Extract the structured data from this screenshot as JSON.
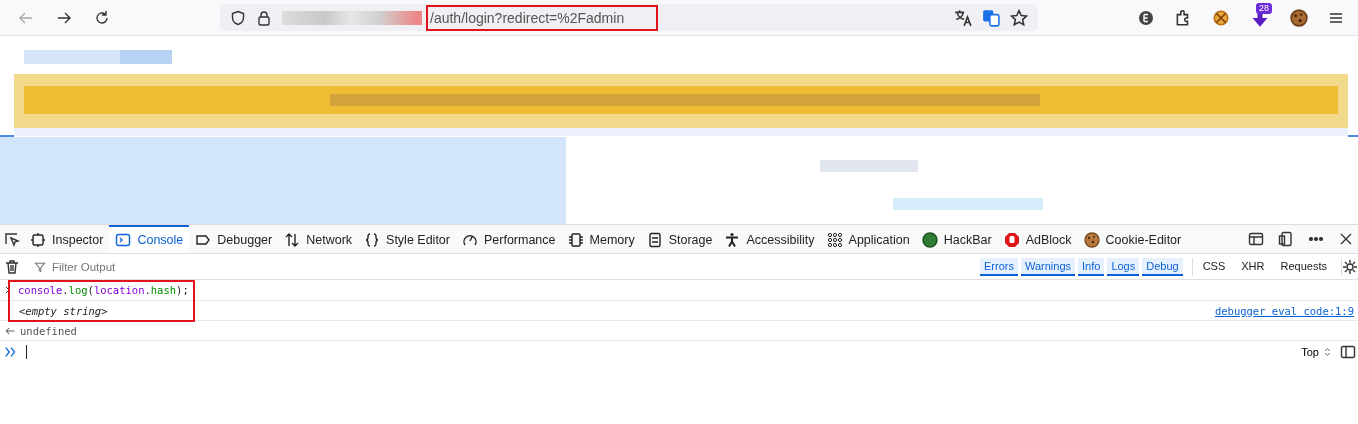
{
  "toolbar": {
    "url": "/auth/login?redirect=%2Fadmin",
    "extension_badge": "28"
  },
  "devtools": {
    "tabs": [
      {
        "label": "Inspector",
        "selected": false
      },
      {
        "label": "Console",
        "selected": true
      },
      {
        "label": "Debugger",
        "selected": false
      },
      {
        "label": "Network",
        "selected": false
      },
      {
        "label": "Style Editor",
        "selected": false
      },
      {
        "label": "Performance",
        "selected": false
      },
      {
        "label": "Memory",
        "selected": false
      },
      {
        "label": "Storage",
        "selected": false
      },
      {
        "label": "Accessibility",
        "selected": false
      },
      {
        "label": "Application",
        "selected": false
      },
      {
        "label": "HackBar",
        "selected": false
      },
      {
        "label": "AdBlock",
        "selected": false
      },
      {
        "label": "Cookie-Editor",
        "selected": false
      }
    ],
    "filter": {
      "placeholder": "Filter Output"
    },
    "levels": [
      {
        "label": "Errors",
        "selected": true
      },
      {
        "label": "Warnings",
        "selected": true
      },
      {
        "label": "Info",
        "selected": true
      },
      {
        "label": "Logs",
        "selected": true
      },
      {
        "label": "Debug",
        "selected": true
      }
    ],
    "types": [
      {
        "label": "CSS",
        "selected": false
      },
      {
        "label": "XHR",
        "selected": false
      },
      {
        "label": "Requests",
        "selected": false
      }
    ],
    "messages": [
      {
        "kind": "input",
        "parts": [
          {
            "text": "console",
            "kind": "name"
          },
          {
            "text": ".",
            "kind": "plain"
          },
          {
            "text": "log",
            "kind": "call"
          },
          {
            "text": "(",
            "kind": "plain"
          },
          {
            "text": "location",
            "kind": "name"
          },
          {
            "text": ".",
            "kind": "plain"
          },
          {
            "text": "hash",
            "kind": "call"
          },
          {
            "text": ");",
            "kind": "plain"
          }
        ]
      },
      {
        "kind": "log",
        "text": "<empty string>",
        "location": "debugger eval code:1:9"
      },
      {
        "kind": "result",
        "text": "undefined"
      }
    ],
    "context": "Top"
  }
}
